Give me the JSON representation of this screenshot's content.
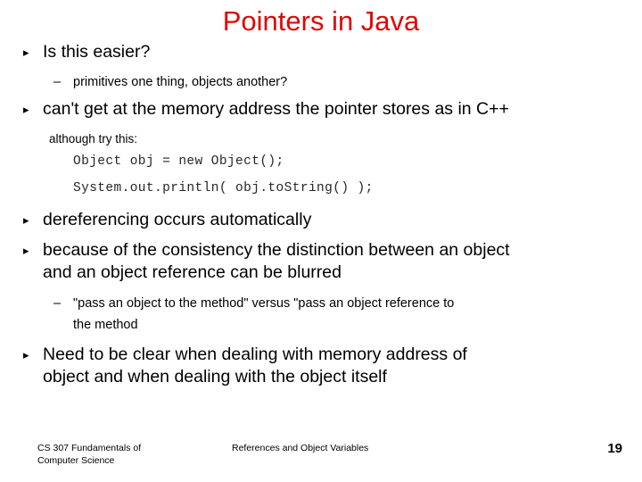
{
  "slide": {
    "title": "Pointers in Java",
    "title_color": "#dd0806",
    "background_color": "#ffffff",
    "text_color": "#000000"
  },
  "bullet_markers": {
    "level1": "▸",
    "level2": "–"
  },
  "content": [
    {
      "level": 1,
      "text": "Is this easier?"
    },
    {
      "level": 2,
      "text": "primitives one thing, objects another?"
    },
    {
      "level": 1,
      "text": "can't get at the memory address the pointer stores as in C++"
    },
    {
      "level": 0,
      "style": "plain",
      "text": "although try this:"
    },
    {
      "level": 0,
      "style": "code",
      "text": "Object obj = new Object();"
    },
    {
      "level": 0,
      "style": "code",
      "text": "System.out.println( obj.toString() );"
    },
    {
      "level": 1,
      "text": "dereferencing occurs automatically"
    },
    {
      "level": 1,
      "text": "because of the consistency the distinction between an object"
    },
    {
      "level": 1,
      "style": "cont",
      "text": "and an object reference can be blurred"
    },
    {
      "level": 2,
      "text": "\"pass an object to the method\" versus \"pass an object reference to"
    },
    {
      "level": 2,
      "style": "cont",
      "text": "the method"
    },
    {
      "level": 1,
      "text": "Need to be clear when dealing with memory address of"
    },
    {
      "level": 1,
      "style": "cont",
      "text": "object and when dealing with the object itself"
    }
  ],
  "footer": {
    "course_line1": "CS 307 Fundamentals of",
    "course_line2": "Computer Science",
    "topic": "References and Object Variables",
    "page_number": "19"
  }
}
